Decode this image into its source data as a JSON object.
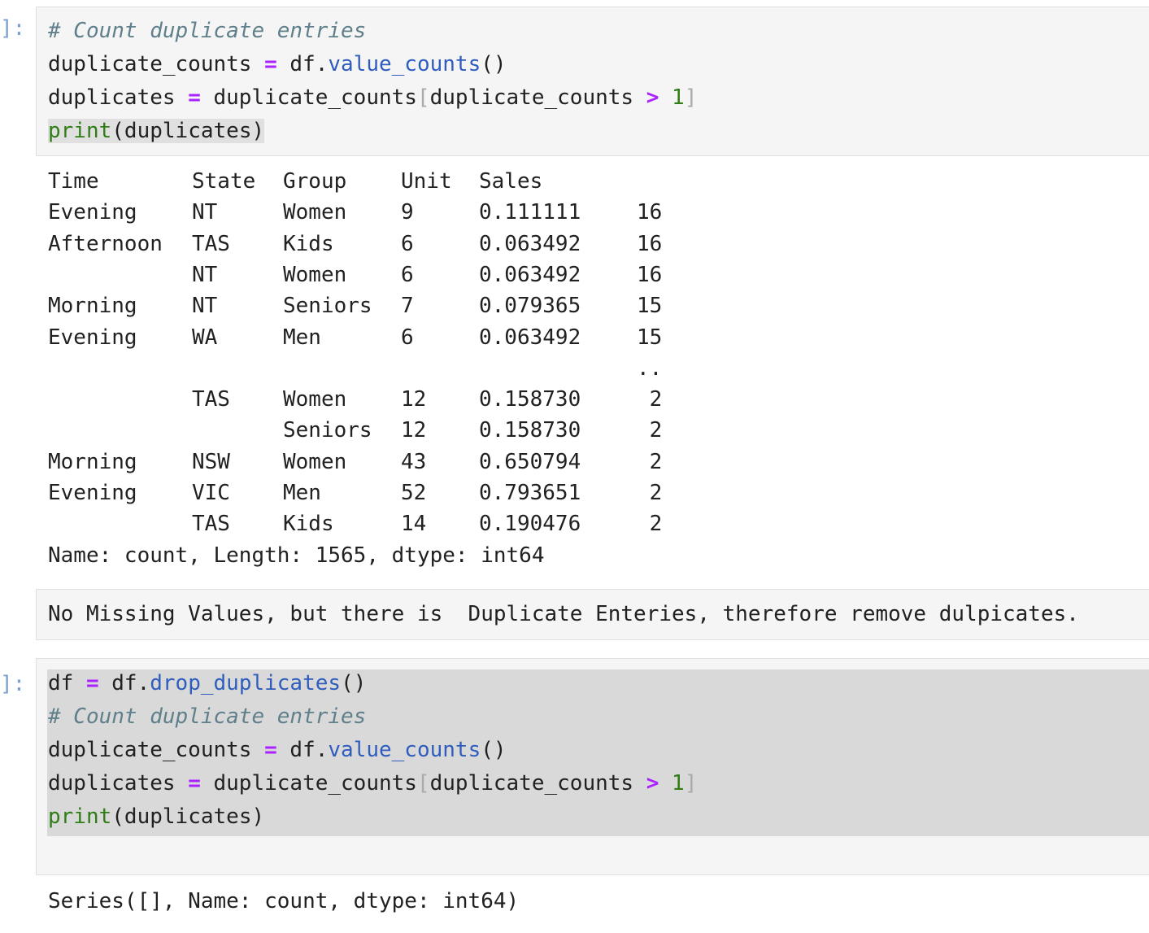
{
  "cells": [
    {
      "prompt": "]:",
      "code": [
        [
          {
            "t": "# Count duplicate entries",
            "c": "cm"
          }
        ],
        [
          {
            "t": "duplicate_counts ",
            "c": ""
          },
          {
            "t": "=",
            "c": "op"
          },
          {
            "t": " df.",
            "c": ""
          },
          {
            "t": "value_counts",
            "c": "fn"
          },
          {
            "t": "()",
            "c": ""
          }
        ],
        [
          {
            "t": "duplicates ",
            "c": ""
          },
          {
            "t": "=",
            "c": "op"
          },
          {
            "t": " duplicate_counts",
            "c": ""
          },
          {
            "t": "[",
            "c": "br"
          },
          {
            "t": "duplicate_counts ",
            "c": ""
          },
          {
            "t": ">",
            "c": "op"
          },
          {
            "t": " ",
            "c": ""
          },
          {
            "t": "1",
            "c": "nm"
          },
          {
            "t": "]",
            "c": "br"
          }
        ],
        [
          {
            "t": "print",
            "c": "bi"
          },
          {
            "t": "(duplicates)",
            "c": ""
          }
        ]
      ]
    },
    {
      "prompt": "]:",
      "code": [
        [
          {
            "t": "df ",
            "c": ""
          },
          {
            "t": "=",
            "c": "op"
          },
          {
            "t": " df.",
            "c": ""
          },
          {
            "t": "drop_duplicates",
            "c": "fn"
          },
          {
            "t": "()",
            "c": ""
          }
        ],
        [
          {
            "t": "# Count duplicate entries",
            "c": "cm"
          }
        ],
        [
          {
            "t": "duplicate_counts ",
            "c": ""
          },
          {
            "t": "=",
            "c": "op"
          },
          {
            "t": " df.",
            "c": ""
          },
          {
            "t": "value_counts",
            "c": "fn"
          },
          {
            "t": "()",
            "c": ""
          }
        ],
        [
          {
            "t": "duplicates ",
            "c": ""
          },
          {
            "t": "=",
            "c": "op"
          },
          {
            "t": " duplicate_counts",
            "c": ""
          },
          {
            "t": "[",
            "c": "br"
          },
          {
            "t": "duplicate_counts ",
            "c": ""
          },
          {
            "t": ">",
            "c": "op"
          },
          {
            "t": " ",
            "c": ""
          },
          {
            "t": "1",
            "c": "nm"
          },
          {
            "t": "]",
            "c": "br"
          }
        ],
        [
          {
            "t": "print",
            "c": "bi"
          },
          {
            "t": "(duplicates)",
            "c": ""
          }
        ]
      ]
    }
  ],
  "output1": {
    "header": [
      "Time",
      "State",
      "Group",
      "Unit",
      "Sales",
      ""
    ],
    "rows": [
      [
        "Evening",
        "NT",
        "Women",
        "9",
        "0.111111",
        "16"
      ],
      [
        "Afternoon",
        "TAS",
        "Kids",
        "6",
        "0.063492",
        "16"
      ],
      [
        "",
        "NT",
        "Women",
        "6",
        "0.063492",
        "16"
      ],
      [
        "Morning",
        "NT",
        "Seniors",
        "7",
        "0.079365",
        "15"
      ],
      [
        "Evening",
        "WA",
        "Men",
        "6",
        "0.063492",
        "15"
      ],
      [
        "",
        "",
        "",
        "",
        "",
        ".."
      ],
      [
        "",
        "TAS",
        "Women",
        "12",
        "0.158730",
        " 2"
      ],
      [
        "",
        "",
        "Seniors",
        "12",
        "0.158730",
        " 2"
      ],
      [
        "Morning",
        "NSW",
        "Women",
        "43",
        "0.650794",
        " 2"
      ],
      [
        "Evening",
        "VIC",
        "Men",
        "52",
        "0.793651",
        " 2"
      ],
      [
        "",
        "TAS",
        "Kids",
        "14",
        "0.190476",
        " 2"
      ]
    ],
    "footer": "Name: count, Length: 1565, dtype: int64"
  },
  "markdown": "No Missing Values, but there is  Duplicate Enteries, therefore remove dulpicates.",
  "output2": "Series([], Name: count, dtype: int64)"
}
